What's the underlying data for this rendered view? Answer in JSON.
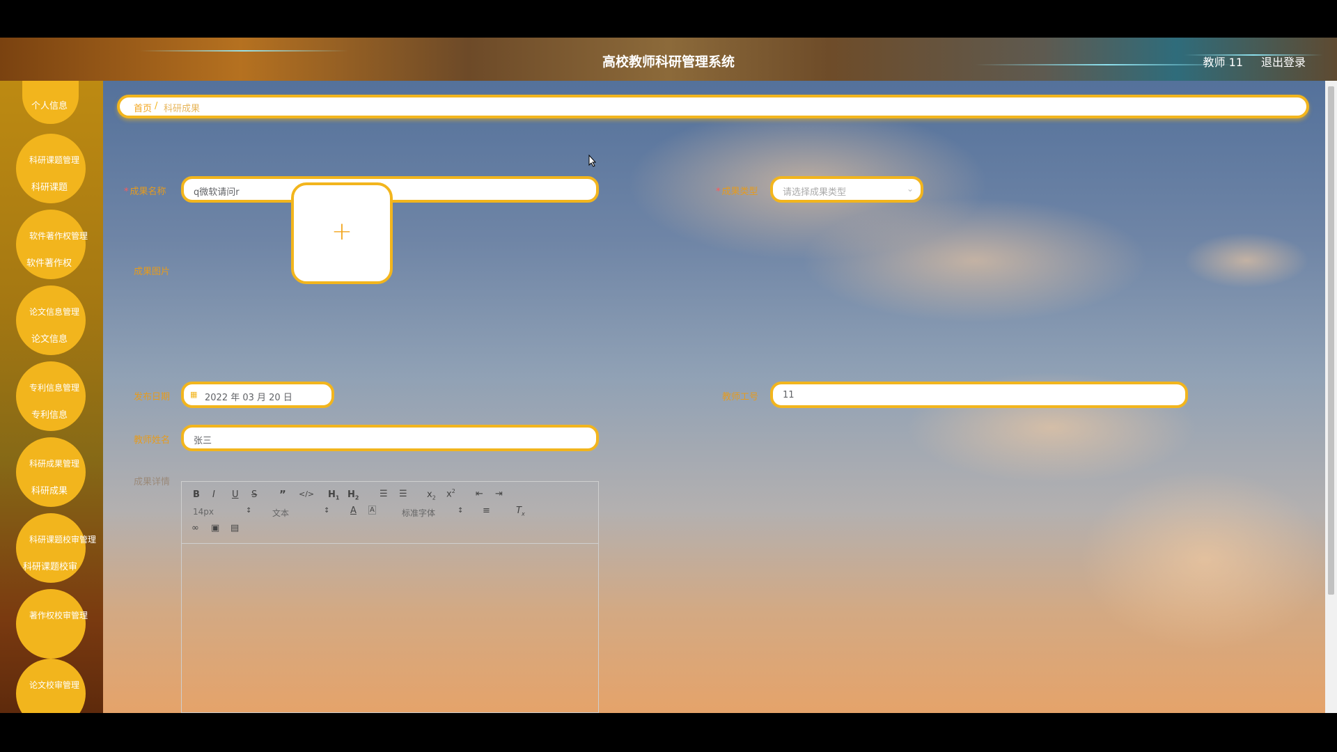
{
  "header": {
    "title": "高校教师科研管理系统",
    "user": "教师 11",
    "logout": "退出登录"
  },
  "sidebar": {
    "top_item": "个人信息",
    "groups": [
      {
        "label": "科研课题管理",
        "sub": "科研课题"
      },
      {
        "label": "软件著作权管理",
        "sub": "软件著作权"
      },
      {
        "label": "论文信息管理",
        "sub": "论文信息"
      },
      {
        "label": "专利信息管理",
        "sub": "专利信息"
      },
      {
        "label": "科研成果管理",
        "sub": "科研成果"
      },
      {
        "label": "科研课题校审管理",
        "sub": "科研课题校审"
      },
      {
        "label": "著作权校审管理",
        "sub": ""
      },
      {
        "label": "论文校审管理",
        "sub": ""
      }
    ]
  },
  "breadcrumb": {
    "home": "首页",
    "separator": "/",
    "current": "科研成果"
  },
  "form": {
    "name_label": "成果名称",
    "name_value": "q微软请问r",
    "type_label": "成果类型",
    "type_placeholder": "请选择成果类型",
    "image_label": "成果图片",
    "upload_icon": "plus-icon",
    "date_label": "发布日期",
    "date_value": "2022 年 03 月 20 日",
    "teacher_id_label": "教师工号",
    "teacher_id_value": "11",
    "teacher_name_label": "教师姓名",
    "teacher_name_value": "张三",
    "detail_label": "成果详情"
  },
  "editor": {
    "font_size": "14px",
    "header_select": "文本",
    "font_family": "标准字体"
  },
  "colors": {
    "accent": "#f2b51d",
    "label": "#e59b1e",
    "sidebar_start": "#bd8a12",
    "sidebar_end": "#5e2a0c"
  }
}
